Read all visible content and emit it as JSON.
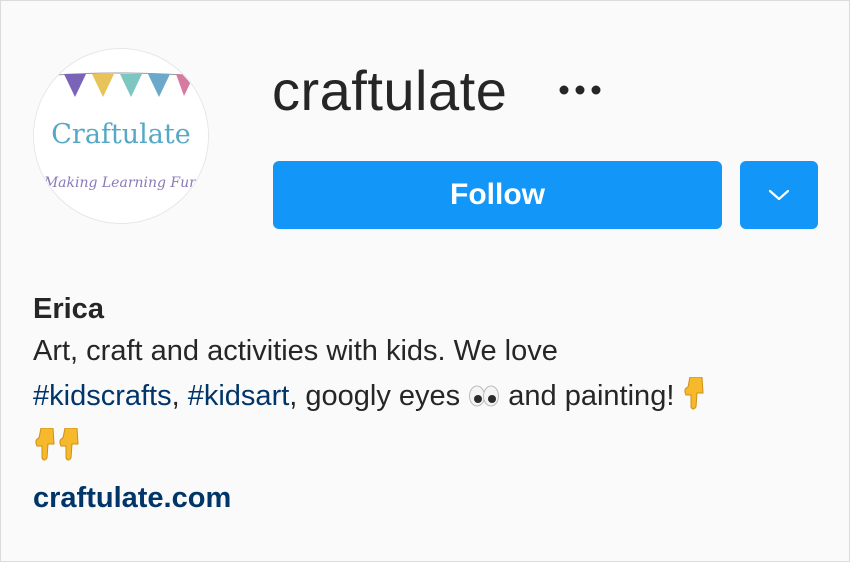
{
  "profile": {
    "username": "craftulate",
    "avatar_logo_title": "Craftulate",
    "avatar_logo_tagline": "Making Learning Fun",
    "name": "Erica",
    "bio_line1": "Art, craft and activities with kids. We love",
    "hashtag1": "#kidscrafts",
    "separator": ", ",
    "hashtag2": "#kidsart",
    "bio_mid": ", googly eyes",
    "bio_end": " and painting!",
    "website": "craftulate.com"
  },
  "actions": {
    "follow_label": "Follow",
    "more_icon": "ellipsis-icon",
    "dropdown_icon": "chevron-down-icon"
  },
  "colors": {
    "primary_button": "#1296f8",
    "link": "#003569",
    "text": "#262626",
    "background": "#fafafa"
  }
}
